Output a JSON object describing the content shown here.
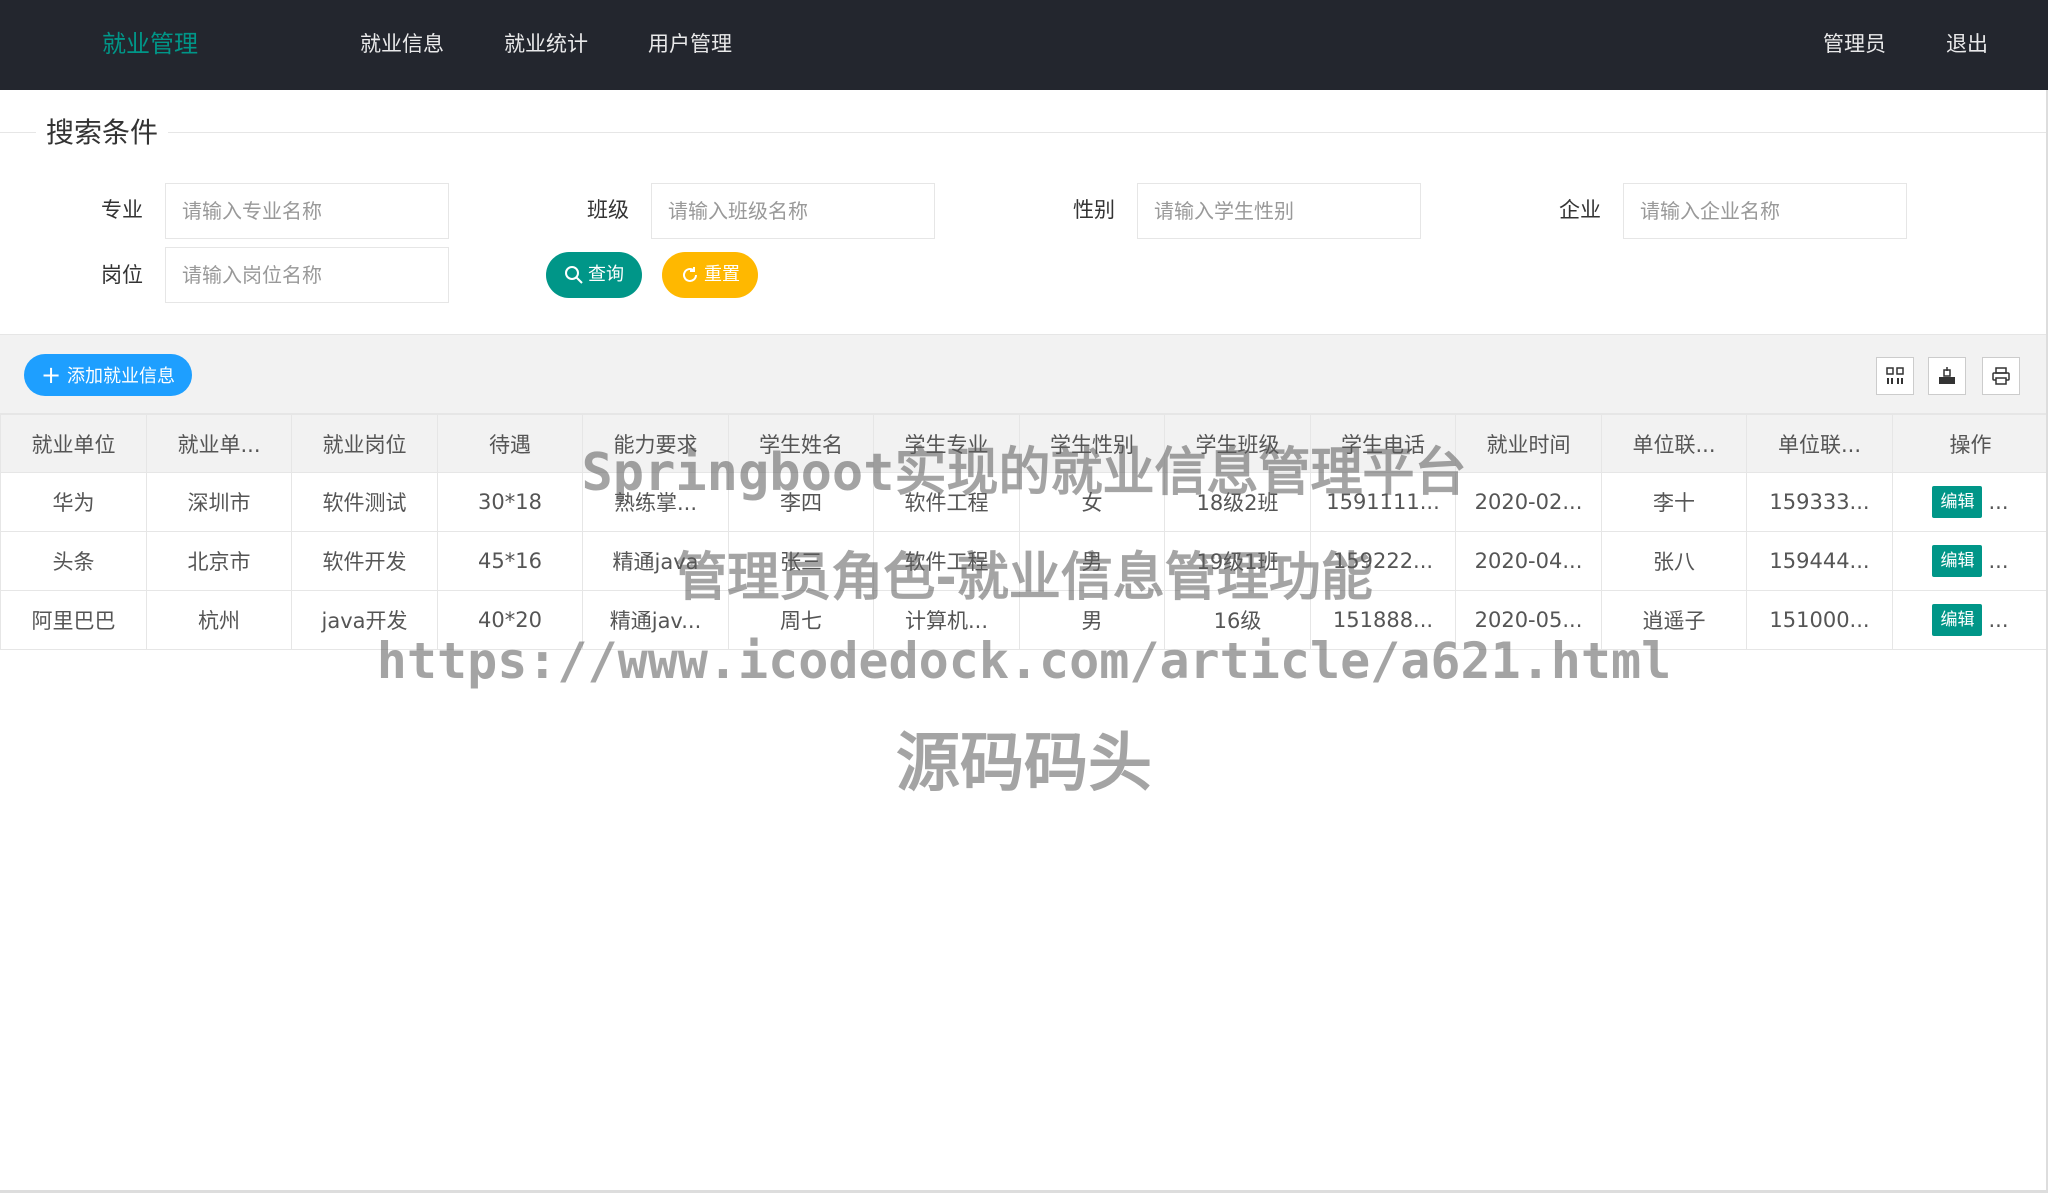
{
  "header": {
    "brand": "就业管理",
    "nav": [
      "就业信息",
      "就业统计",
      "用户管理"
    ],
    "user": "管理员",
    "logout": "退出"
  },
  "search": {
    "legend": "搜索条件",
    "fields": [
      {
        "label": "专业",
        "placeholder": "请输入专业名称"
      },
      {
        "label": "班级",
        "placeholder": "请输入班级名称"
      },
      {
        "label": "性别",
        "placeholder": "请输入学生性别"
      },
      {
        "label": "企业",
        "placeholder": "请输入企业名称"
      },
      {
        "label": "岗位",
        "placeholder": "请输入岗位名称"
      }
    ],
    "query_label": "查询",
    "reset_label": "重置"
  },
  "toolbar": {
    "add_label": "添加就业信息",
    "icons": [
      "columns-icon",
      "export-icon",
      "print-icon"
    ]
  },
  "table": {
    "headers": [
      "就业单位",
      "就业单...",
      "就业岗位",
      "待遇",
      "能力要求",
      "学生姓名",
      "学生专业",
      "学生性别",
      "学生班级",
      "学生电话",
      "就业时间",
      "单位联...",
      "单位联...",
      "操作"
    ],
    "rows": [
      [
        "华为",
        "深圳市",
        "软件测试",
        "30*18",
        "熟练掌...",
        "李四",
        "软件工程",
        "女",
        "18级2班",
        "1591111...",
        "2020-02...",
        "李十",
        "159333..."
      ],
      [
        "头条",
        "北京市",
        "软件开发",
        "45*16",
        "精通java",
        "张三",
        "软件工程",
        "男",
        "19级1班",
        "159222...",
        "2020-04...",
        "张八",
        "159444..."
      ],
      [
        "阿里巴巴",
        "杭州",
        "java开发",
        "40*20",
        "精通jav...",
        "周七",
        "计算机...",
        "男",
        "16级",
        "151888...",
        "2020-05...",
        "逍遥子",
        "151000..."
      ]
    ],
    "edit_label": "编辑",
    "more_label": "..."
  },
  "watermark": {
    "line1": "Springboot实现的就业信息管理平台",
    "line2": "管理员角色-就业信息管理功能",
    "line3": "https://www.icodedock.com/article/a621.html",
    "line4": "源码码头"
  }
}
